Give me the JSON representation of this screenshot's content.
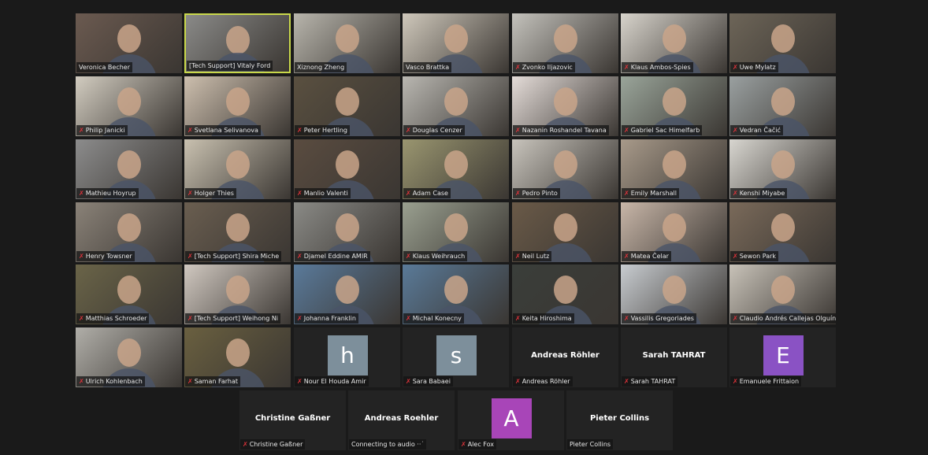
{
  "colors": {
    "active_speaker_border": "#c9d84a",
    "muted_icon": "#e0333a",
    "background": "#1a1a1a",
    "tile": "#232323"
  },
  "rows": [
    [
      {
        "name": "Veronica Becher",
        "muted": false,
        "tone": "#6b5a50"
      },
      {
        "name": "[Tech Support] Vitaly Ford",
        "muted": false,
        "tone": "#8a8a88",
        "active": true
      },
      {
        "name": "Xiznong Zheng",
        "muted": false,
        "tone": "#b8b5ac"
      },
      {
        "name": "Vasco Brattka",
        "muted": false,
        "tone": "#cfc8bb"
      },
      {
        "name": "Zvonko Iljazovic",
        "muted": true,
        "tone": "#c4c2bc"
      },
      {
        "name": "Klaus Ambos-Spies",
        "muted": true,
        "tone": "#d8d4cc"
      },
      {
        "name": "Uwe Mylatz",
        "muted": true,
        "tone": "#6d6558"
      }
    ],
    [
      {
        "name": "Philip Janicki",
        "muted": true,
        "tone": "#d2ccc0"
      },
      {
        "name": "Svetlana Selivanova",
        "muted": true,
        "tone": "#cdbfae"
      },
      {
        "name": "Peter Hertling",
        "muted": true,
        "tone": "#5a5040"
      },
      {
        "name": "Douglas Cenzer",
        "muted": true,
        "tone": "#b9b7b1"
      },
      {
        "name": "Nazanin Roshandel Tavana",
        "muted": true,
        "tone": "#e4dcd8"
      },
      {
        "name": "Gabriel Sac Himelfarb",
        "muted": true,
        "tone": "#9aa59a"
      },
      {
        "name": "Vedran Čačić",
        "muted": true,
        "tone": "#9aa0a0"
      }
    ],
    [
      {
        "name": "Mathieu Hoyrup",
        "muted": true,
        "tone": "#8c8c8c"
      },
      {
        "name": "Holger Thies",
        "muted": true,
        "tone": "#c9c1b0"
      },
      {
        "name": "Manlio Valenti",
        "muted": true,
        "tone": "#5a4c40"
      },
      {
        "name": "Adam Case",
        "muted": true,
        "tone": "#9a9670"
      },
      {
        "name": "Pedro Pinto",
        "muted": true,
        "tone": "#c8c4bc"
      },
      {
        "name": "Emily Marshall",
        "muted": true,
        "tone": "#a89a8a"
      },
      {
        "name": "Kenshi Miyabe",
        "muted": true,
        "tone": "#d8d6d0"
      }
    ],
    [
      {
        "name": "Henry Towsner",
        "muted": true,
        "tone": "#8a8278"
      },
      {
        "name": "[Tech Support] Shira Miche",
        "muted": true,
        "tone": "#6a5e50"
      },
      {
        "name": "Djamel Eddine AMIR",
        "muted": true,
        "tone": "#8a8a86"
      },
      {
        "name": "Klaus Weihrauch",
        "muted": true,
        "tone": "#9aa090"
      },
      {
        "name": "Neil Lutz",
        "muted": true,
        "tone": "#6a5a48"
      },
      {
        "name": "Matea Čelar",
        "muted": true,
        "tone": "#c8b6a8"
      },
      {
        "name": "Sewon Park",
        "muted": true,
        "tone": "#7a6a5a"
      }
    ],
    [
      {
        "name": "Matthias Schroeder",
        "muted": true,
        "tone": "#6a6448"
      },
      {
        "name": "[Tech Support] Weihong Ni",
        "muted": true,
        "tone": "#d0c8c0"
      },
      {
        "name": "Johanna Franklin",
        "muted": true,
        "tone": "#5a7a9a"
      },
      {
        "name": "Michal Konecny",
        "muted": true,
        "tone": "#5a7a98"
      },
      {
        "name": "Keita Hiroshima",
        "muted": true,
        "tone": "#3a3e3a"
      },
      {
        "name": "Vassilis Gregoriades",
        "muted": true,
        "tone": "#c8ccd0"
      },
      {
        "name": "Claudio Andrés Callejas Olguín",
        "muted": true,
        "tone": "#c8c2b8"
      }
    ],
    [
      {
        "name": "Ulrich Kohlenbach",
        "muted": true,
        "tone": "#b0aea8"
      },
      {
        "name": "Saman Farhat",
        "muted": true,
        "tone": "#6a6040"
      },
      {
        "name": "Nour El Houda Amir",
        "muted": true,
        "avatar": "h",
        "avatar_color": "#7d8f9b"
      },
      {
        "name": "Sara Babaei",
        "muted": true,
        "avatar": "s",
        "avatar_color": "#7d8f9b"
      },
      {
        "name": "Andreas Röhler",
        "muted": true,
        "display": "Andreas Röhler"
      },
      {
        "name": "Sarah TAHRAT",
        "muted": true,
        "display": "Sarah TAHRAT"
      },
      {
        "name": "Emanuele Frittaion",
        "muted": true,
        "avatar": "E",
        "avatar_color": "#8a52c4"
      }
    ],
    [
      {
        "name": "Christine Gaßner",
        "muted": true,
        "display": "Christine Gaßner"
      },
      {
        "name": "Connecting to audio ··˙",
        "muted": false,
        "display": "Andreas Roehler"
      },
      {
        "name": "Alec Fox",
        "muted": true,
        "avatar": "A",
        "avatar_color": "#a845b8"
      },
      {
        "name": "Pieter Collins",
        "muted": false,
        "display": "Pieter Collins"
      }
    ]
  ]
}
